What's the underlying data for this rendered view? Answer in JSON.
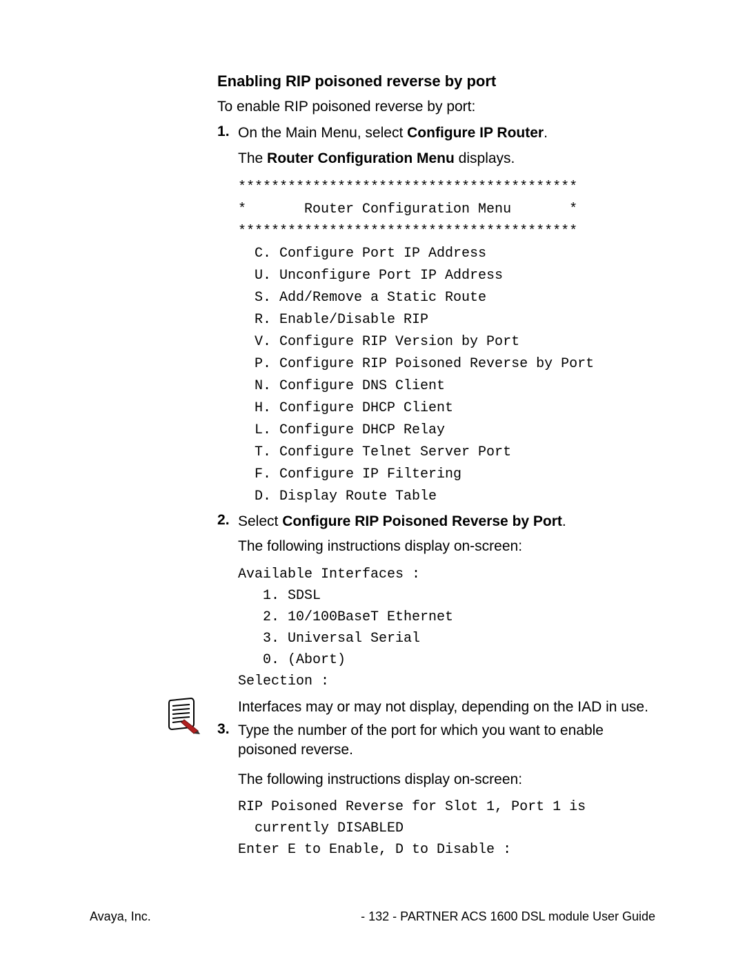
{
  "heading": "Enabling RIP poisoned reverse by port",
  "intro": "To enable RIP poisoned reverse by port:",
  "steps": {
    "s1": {
      "prefix": "On the Main Menu, select ",
      "bold": "Configure IP Router",
      "suffix": ".",
      "line2_prefix": "The ",
      "line2_bold": "Router Configuration Menu",
      "line2_suffix": " displays."
    },
    "menu": "*****************************************\n*       Router Configuration Menu       *\n*****************************************\n  C. Configure Port IP Address\n  U. Unconfigure Port IP Address\n  S. Add/Remove a Static Route\n  R. Enable/Disable RIP\n  V. Configure RIP Version by Port\n  P. Configure RIP Poisoned Reverse by Port\n  N. Configure DNS Client\n  H. Configure DHCP Client\n  L. Configure DHCP Relay\n  T. Configure Telnet Server Port\n  F. Configure IP Filtering\n  D. Display Route Table",
    "s2": {
      "prefix": "Select ",
      "bold": "Configure RIP Poisoned Reverse by Port",
      "suffix": ".",
      "line2": "The following instructions display on-screen:"
    },
    "interfaces": "Available Interfaces :\n   1. SDSL\n   2. 10/100BaseT Ethernet\n   3. Universal Serial\n   0. (Abort)\nSelection :",
    "note": "Interfaces may or may not display, depending on the IAD in use.",
    "s3": {
      "line1": "Type the number of the port for which you want to enable poisoned reverse.",
      "line2": "The following instructions display on-screen:"
    },
    "status": "RIP Poisoned Reverse for Slot 1, Port 1 is\n  currently DISABLED\nEnter E to Enable, D to Disable :"
  },
  "footer": {
    "left": "Avaya, Inc.",
    "center": "- 132 -",
    "right": "PARTNER ACS 1600 DSL module User Guide"
  }
}
